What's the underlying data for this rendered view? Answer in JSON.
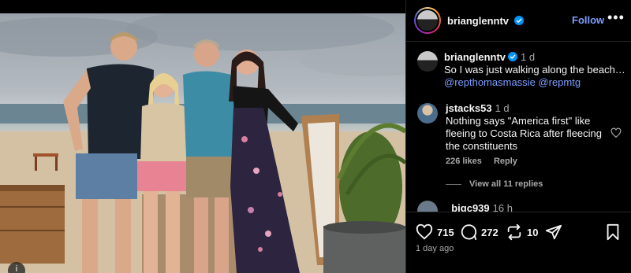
{
  "post": {
    "username": "brianglenntv",
    "follow_label": "Follow",
    "more_label": "•••",
    "caption_time": "1 d",
    "caption_text": "So I was just walking along the beach…",
    "mentions": [
      "@repthomasmassie",
      "@repmtg"
    ]
  },
  "comments": [
    {
      "username": "jstacks53",
      "time": "1 d",
      "text": "Nothing says \"America first\" like fleeing to Costa Rica after fleecing the constituents",
      "likes": "226 likes",
      "reply_label": "Reply",
      "view_replies": "View all 11 replies"
    },
    {
      "username": "_bigc939",
      "time": "16 h"
    }
  ],
  "actions": {
    "likes_count": "715",
    "comments_count": "272",
    "reposts_count": "10"
  },
  "date": "1 day ago",
  "photo_info": "i",
  "colors": {
    "accent": "#7c9cff",
    "verified": "#0095f6",
    "muted": "#a8a8a8"
  }
}
